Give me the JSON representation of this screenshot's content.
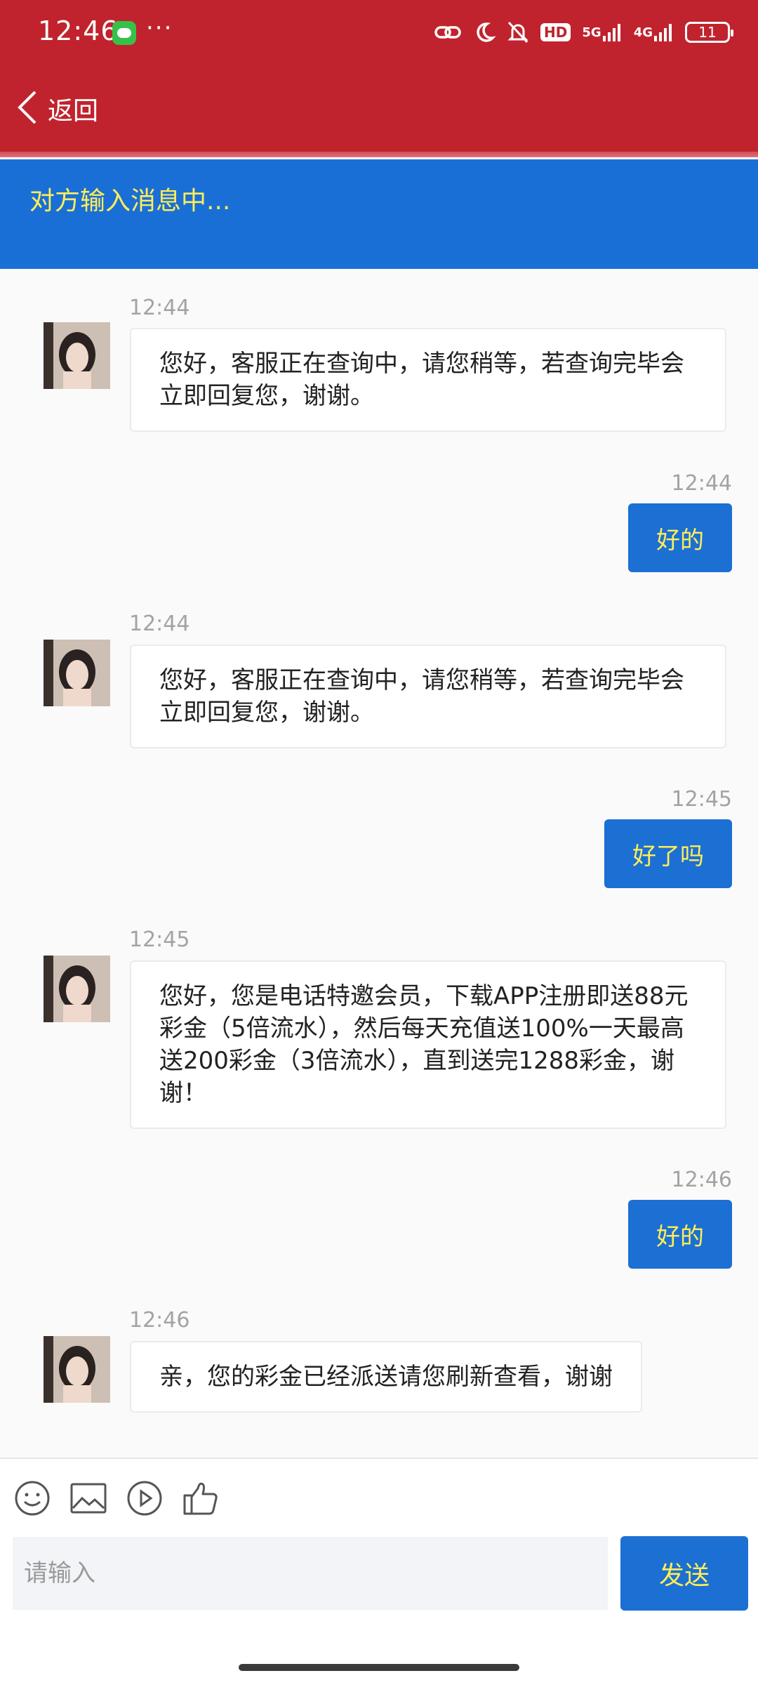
{
  "status_bar": {
    "time": "12:46",
    "more": "···",
    "hd_badge": "HD",
    "net1": "5G",
    "net2": "4G",
    "battery": "11"
  },
  "header": {
    "back_label": "返回"
  },
  "typing_notice": "对方输入消息中...",
  "messages": [
    {
      "side": "in",
      "time": "12:44",
      "text": "您好，客服正在查询中，请您稍等，若查询完毕会立即回复您，谢谢。"
    },
    {
      "side": "out",
      "time": "12:44",
      "text": "好的"
    },
    {
      "side": "in",
      "time": "12:44",
      "text": "您好，客服正在查询中，请您稍等，若查询完毕会立即回复您，谢谢。"
    },
    {
      "side": "out",
      "time": "12:45",
      "text": "好了吗"
    },
    {
      "side": "in",
      "time": "12:45",
      "text": "您好，您是电话特邀会员，下载APP注册即送88元彩金（5倍流水），然后每天充值送100%一天最高送200彩金（3倍流水），直到送完1288彩金，谢谢！"
    },
    {
      "side": "out",
      "time": "12:46",
      "text": "好的"
    },
    {
      "side": "in",
      "time": "12:46",
      "text": "亲，您的彩金已经派送请您刷新查看，谢谢"
    }
  ],
  "toolbar": {
    "icons": [
      "emoji-icon",
      "image-icon",
      "video-icon",
      "thumbs-up-icon"
    ]
  },
  "composer": {
    "placeholder": "请输入",
    "send_label": "发送"
  },
  "colors": {
    "header_red": "#c0232d",
    "accent_blue": "#1c6fd3",
    "accent_yellow": "#ffee58"
  }
}
